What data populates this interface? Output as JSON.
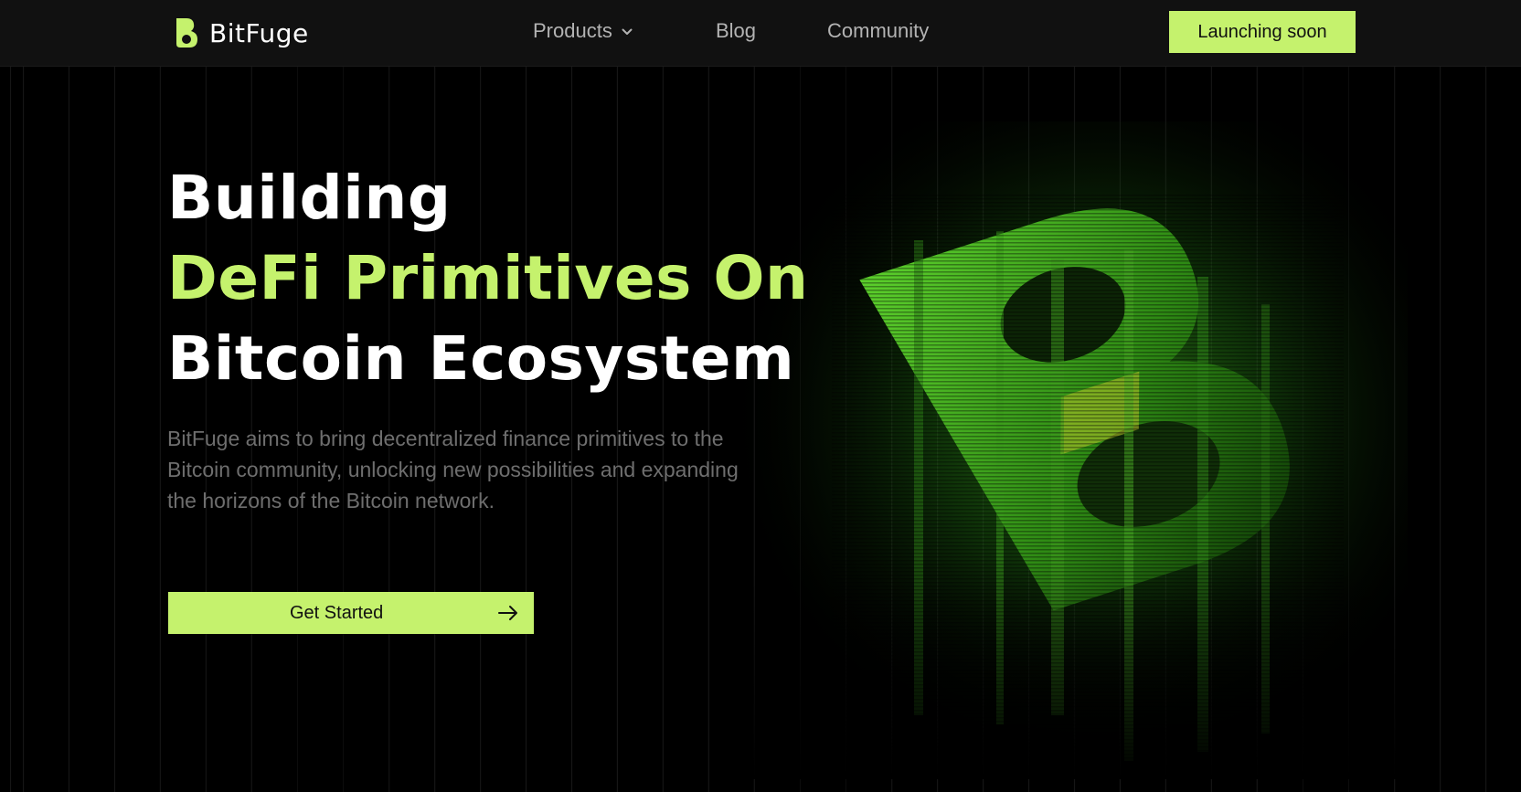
{
  "brand": {
    "name": "BitFuge",
    "accent_color": "#c5f26d"
  },
  "nav": {
    "items": [
      {
        "label": "Products",
        "has_dropdown": true,
        "icon": "chevron-down-icon"
      },
      {
        "label": "Blog"
      },
      {
        "label": "Community"
      }
    ],
    "cta_label": "Launching soon"
  },
  "hero": {
    "headline_line1": "Building",
    "headline_line2": "DeFi Primitives On",
    "headline_line3": "Bitcoin Ecosystem",
    "description": "BitFuge aims to bring decentralized finance primitives to the Bitcoin community, unlocking new possibilities and expanding the horizons of the Bitcoin network.",
    "button_label": "Get Started",
    "button_icon": "arrow-right-icon",
    "art_icon": "bitfuge-b-logo-graphic"
  }
}
